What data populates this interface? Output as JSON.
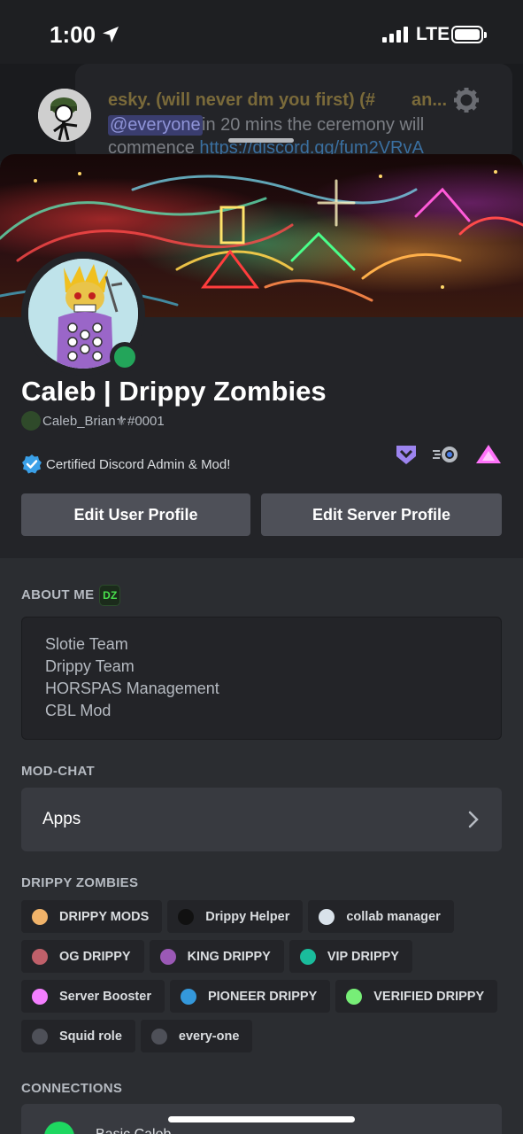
{
  "status_bar": {
    "time": "1:00",
    "network": "LTE"
  },
  "notification": {
    "title": "esky. (will never dm you first) (#",
    "title_suffix": "an...",
    "mention": "@everyone",
    "message_line1": " in 20 mins the ceremony will",
    "message_line2_prefix": "commence ",
    "message_link": "https://discord.gg/fum2VRvA"
  },
  "profile": {
    "display_name": "Caleb | Drippy Zombies",
    "username": "Caleb_Brian⚜#0001",
    "custom_status": "Certified Discord Admin & Mod!",
    "status": "online",
    "edit_user_label": "Edit User Profile",
    "edit_server_label": "Edit Server Profile"
  },
  "about_me": {
    "title": "ABOUT ME",
    "emoji": "DZ",
    "lines": [
      "Slotie Team",
      "Drippy Team",
      "HORSPAS Management",
      "CBL Mod"
    ]
  },
  "mod_chat": {
    "title": "MOD-CHAT",
    "apps_label": "Apps"
  },
  "roles_section": {
    "title": "DRIPPY ZOMBIES",
    "roles": [
      {
        "name": "DRIPPY MODS",
        "color": "#f0b36a"
      },
      {
        "name": "Drippy Helper",
        "color": "#111111"
      },
      {
        "name": "collab manager",
        "color": "#d9e2ea"
      },
      {
        "name": "OG DRIPPY",
        "color": "#c0606a"
      },
      {
        "name": "KING DRIPPY",
        "color": "#9b59b6"
      },
      {
        "name": "VIP DRIPPY",
        "color": "#1abc9c"
      },
      {
        "name": "Server Booster",
        "color": "#f47fff"
      },
      {
        "name": "PIONEER DRIPPY",
        "color": "#3498db"
      },
      {
        "name": "VERIFIED DRIPPY",
        "color": "#77ee77"
      },
      {
        "name": "Squid role",
        "color": "#4e5058"
      },
      {
        "name": "every-one",
        "color": "#4e5058"
      }
    ]
  },
  "connections": {
    "title": "CONNECTIONS",
    "first_name": "Basic Caleb"
  }
}
